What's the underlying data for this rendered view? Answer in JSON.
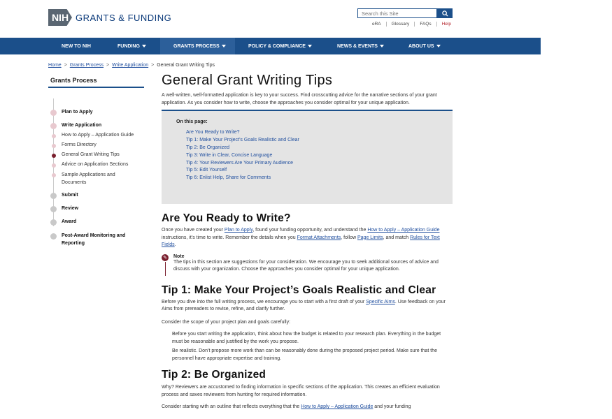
{
  "header": {
    "logo_mark": "NIH",
    "logo_text": "GRANTS & FUNDING",
    "search_placeholder": "Search this Site",
    "utility": [
      "eRA",
      "Glossary",
      "FAQs",
      "Help"
    ]
  },
  "nav": {
    "items": [
      "NEW TO NIH",
      "FUNDING",
      "GRANTS PROCESS",
      "POLICY & COMPLIANCE",
      "NEWS & EVENTS",
      "ABOUT US"
    ]
  },
  "breadcrumb": [
    "Home",
    "Grants Process",
    "Write Application",
    "General Grant Writing Tips"
  ],
  "sidebar": {
    "title": "Grants Process",
    "items": [
      "Plan to Apply",
      "Write Application",
      "How to Apply – Application Guide",
      "Forms Directory",
      "General Grant Writing Tips",
      "Advice on Application Sections",
      "Sample Applications and Documents",
      "Submit",
      "Review",
      "Award",
      "Post-Award Monitoring and Reporting"
    ]
  },
  "main": {
    "title": "General Grant Writing Tips",
    "intro": "A well-written, well-formatted application is key to your success. Find crosscutting advice for the narrative sections of your grant application. As you consider how to write, choose the approaches you consider optimal for your unique application.",
    "on_this_page": {
      "title": "On this page:",
      "links": [
        "Are You Ready to Write?",
        "Tip 1: Make Your Project’s Goals Realistic and Clear",
        "Tip 2: Be Organized",
        "Tip 3: Write in Clear, Concise Language",
        "Tip 4: Your Reviewers Are Your Primary Audience",
        "Tip 5: Edit Yourself",
        "Tip 6: Enlist Help, Share for Comments"
      ]
    },
    "ready": {
      "heading": "Are You Ready to Write?",
      "p1_a": "Once you have created your ",
      "p1_link1": "Plan to Apply",
      "p1_b": ", found your funding opportunity, and understand the ",
      "p1_link2": "How to Apply – Application Guide",
      "p1_c": " instructions, it’s time to write. Remember the details when you ",
      "p1_link3": "Format Attachments",
      "p1_d": ", follow ",
      "p1_link4": "Page Limits",
      "p1_e": ", and match ",
      "p1_link5": "Rules for Text Fields",
      "p1_f": ".",
      "note_title": "Note",
      "note_text": "The tips in this section are suggestions for your consideration. We encourage you to seek additional sources of advice and discuss with your organization. Choose the approaches you consider optimal for your unique application."
    },
    "tip1": {
      "heading": "Tip 1: Make Your Project’s Goals Realistic and Clear",
      "p1_a": "Before you dive into the full writing process, we encourage you to start with a first draft of your ",
      "p1_link": "Specific Aims",
      "p1_b": ". Use feedback on your Aims from prereaders to revise, refine, and clarify further.",
      "p2": "Consider the scope of your project plan and goals carefully:",
      "bullets": [
        "Before you start writing the application, think about how the budget is related to your research plan. Everything in the budget must be reasonable and justified by the work you propose.",
        "Be realistic. Don’t propose more work than can be reasonably done during the proposed project period. Make sure that the personnel have appropriate expertise and training."
      ]
    },
    "tip2": {
      "heading": "Tip 2: Be Organized",
      "p1": "Why? Reviewers are accustomed to finding information in specific sections of the application. This creates an efficient evaluation process and saves reviewers from hunting for required information.",
      "p2_a": "Consider starting with an outline that reflects everything that the ",
      "p2_link": "How to Apply – Application Guide",
      "p2_b": " and your funding"
    }
  }
}
